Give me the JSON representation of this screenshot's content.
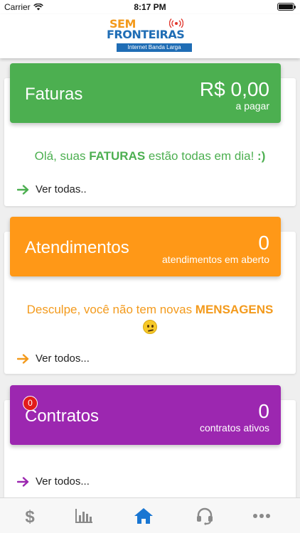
{
  "status": {
    "carrier": "Carrier",
    "time": "8:17 PM",
    "battery_level": 1.0
  },
  "header": {
    "logo_line1": "SEM",
    "logo_line2": "FRONTEIRAS",
    "logo_tagline": "Internet Banda Larga"
  },
  "faturas": {
    "title": "Faturas",
    "value": "R$ 0,00",
    "subtitle": "a pagar",
    "message_pre": "Olá, suas ",
    "message_strong": "FATURAS",
    "message_post": " estão todas em dia! ",
    "message_smiley": ":)",
    "link_label": "Ver todas..",
    "color": "#4caf50"
  },
  "atendimentos": {
    "title": "Atendimentos",
    "value": "0",
    "subtitle": "atendimentos em aberto",
    "message_pre": "Desculpe, você não tem novas ",
    "message_strong": "MENSAGENS",
    "link_label": "Ver todos...",
    "color": "#ff9817"
  },
  "contratos": {
    "title": "Contratos",
    "value": "0",
    "subtitle": "contratos ativos",
    "badge": "0",
    "link_label": "Ver todos...",
    "color": "#9c27b0"
  },
  "tabbar": {
    "active_color": "#1976d2",
    "inactive_color": "#8a8a8a",
    "tabs": [
      {
        "icon": "dollar-icon",
        "active": false
      },
      {
        "icon": "bar-chart-icon",
        "active": false
      },
      {
        "icon": "home-icon",
        "active": true
      },
      {
        "icon": "headset-icon",
        "active": false
      },
      {
        "icon": "more-icon",
        "active": false
      }
    ]
  }
}
